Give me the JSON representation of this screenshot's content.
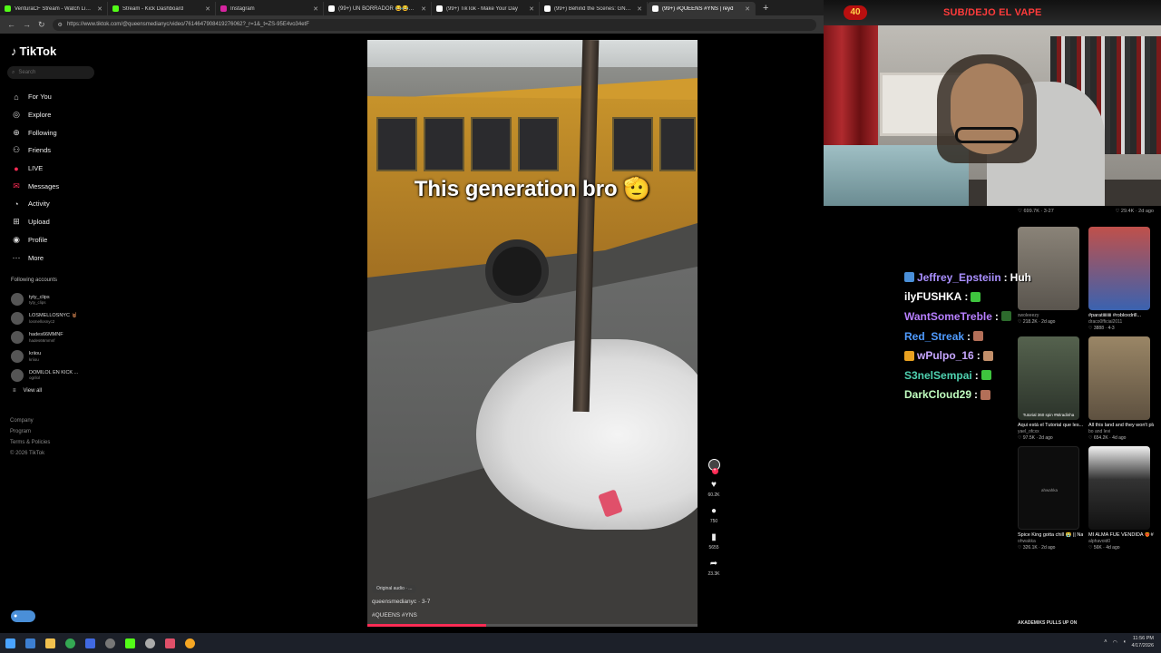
{
  "browser": {
    "tabs": [
      {
        "label": "VenturaCF Stream - Watch Live o",
        "favicon_color": "#53fc18",
        "active": false
      },
      {
        "label": "Stream - Kick Dashboard",
        "favicon_color": "#53fc18",
        "active": false
      },
      {
        "label": "Instagram",
        "favicon_color": "#d6249f",
        "active": false
      },
      {
        "label": "(99+) UN BORRADOR 😂😂😂 | #",
        "favicon_color": "#ffffff",
        "active": false
      },
      {
        "label": "(99+) TikTok - Make Your Day",
        "favicon_color": "#ffffff",
        "active": false
      },
      {
        "label": "(99+) Behind the Scenes: GNG's",
        "favicon_color": "#ffffff",
        "active": false
      },
      {
        "label": "(99+) #QUEENS #YNS | reyd",
        "favicon_color": "#ffffff",
        "active": true
      }
    ],
    "url": "https://www.tiktok.com/@queensmedianyc/video/7614647908419276062?_r=1&_t=ZS-95E4vo34etF"
  },
  "tiktok": {
    "logo": "TikTok",
    "search_placeholder": "Search",
    "nav": [
      {
        "label": "For You",
        "icon": "home-icon"
      },
      {
        "label": "Explore",
        "icon": "compass-icon"
      },
      {
        "label": "Following",
        "icon": "following-icon"
      },
      {
        "label": "Friends",
        "icon": "friends-icon"
      },
      {
        "label": "LIVE",
        "icon": "live-icon"
      },
      {
        "label": "Messages",
        "icon": "messages-icon"
      },
      {
        "label": "Activity",
        "icon": "activity-icon"
      },
      {
        "label": "Upload",
        "icon": "upload-icon"
      },
      {
        "label": "Profile",
        "icon": "profile-icon"
      },
      {
        "label": "More",
        "icon": "more-icon"
      }
    ],
    "following_title": "Following accounts",
    "following": [
      {
        "name": "tyty_clips",
        "sub": "tyty_clips"
      },
      {
        "name": "LOSMELLOSNYC 🤘🏾",
        "sub": "losmellosnyc2"
      },
      {
        "name": "hades66MMNF",
        "sub": "hades66mmnf"
      },
      {
        "name": "kriiou",
        "sub": "kriiou"
      },
      {
        "name": "DOMILOL EN KICK ...",
        "sub": "ogrilol"
      }
    ],
    "view_all": "View all",
    "footer": [
      "Company",
      "Program",
      "Terms & Policies",
      "© 2026 TikTok"
    ]
  },
  "video": {
    "caption": "This generation bro 🫡",
    "author": "queensmedianyc · 3-7",
    "hashtags": "#QUEENS #YNS",
    "pill": "Original audio · ...",
    "progress": 0.36,
    "likes": "60.2K",
    "comments": "750",
    "saves": "5655",
    "shares": "23.3K"
  },
  "stream": {
    "badge": "40",
    "title": "SUB/DEJO EL VAPE"
  },
  "chat": [
    {
      "user": "Jeffrey_Epsteiin",
      "color": "#a98fff",
      "text": "Huh",
      "has_icon": true,
      "emote_color": ""
    },
    {
      "user": "ilyFUSHKA",
      "color": "#ffffff",
      "text": "",
      "has_icon": false,
      "emote_color": "#3ec43e"
    },
    {
      "user": "WantSomeTreble",
      "color": "#b77fff",
      "text": "",
      "has_icon": false,
      "emote_color": "#2d6b2d"
    },
    {
      "user": "Red_Streak",
      "color": "#4f9bff",
      "text": "",
      "has_icon": false,
      "emote_color": "#b36f58"
    },
    {
      "user": "wPulpo_16",
      "color": "#c7a7ff",
      "text": "",
      "has_icon": true,
      "emote_color": "#c28f6a"
    },
    {
      "user": "S3nelSempai",
      "color": "#4fd1b0",
      "text": "",
      "has_icon": false,
      "emote_color": "#3ec43e"
    },
    {
      "user": "DarkCloud29",
      "color": "#c1ffc0",
      "text": "",
      "has_icon": false,
      "emote_color": "#b36f58"
    }
  ],
  "right_panel": {
    "top_left": "♡ 699.7K · 3-27",
    "top_right": "♡ 29.4K · 2d ago",
    "cards": [
      {
        "thumb_color": "#6e6a63",
        "overlay": "",
        "title": "",
        "author": "swoleeezy",
        "stats": "♡ 218.2K · 2d ago"
      },
      {
        "thumb_color": "#3a62b0",
        "overlay": "",
        "title": "#paratiiiiiiii #robloxdrill...",
        "author": "draco0fficial2011",
        "stats": "♡ 3888 · 4-3"
      },
      {
        "thumb_color": "#3d4a3c",
        "overlay": "Tutorial 360 spin #Miradinha",
        "title": "Aqui está el Tutorial que les...",
        "author": "yael_ofcxx",
        "stats": "♡ 97.5K · 2d ago"
      },
      {
        "thumb_color": "#7a6a52",
        "overlay": "",
        "title": "All this land and they won't play...",
        "author": "bo and levi",
        "stats": "♡ 654.2K · 4d ago"
      },
      {
        "thumb_color": "#0d0d0d",
        "overlay": "ahwahka",
        "title": "Spice King gotta chill 😭 || Naoya...",
        "author": "ohwakka",
        "stats": "♡ 326.1K · 2d ago"
      },
      {
        "thumb_color": "#2a2a2a",
        "overlay": "",
        "title": "MI ALMA FUE VENDIDA ❤️‍🔥#lyric...",
        "author": "alphavoid0",
        "stats": "♡ 56K · 4d ago"
      }
    ],
    "bottom_title": "AKADEMIKS PULLS UP ON"
  },
  "taskbar": {
    "time": "11:56 PM",
    "date": "4/17/2026"
  }
}
